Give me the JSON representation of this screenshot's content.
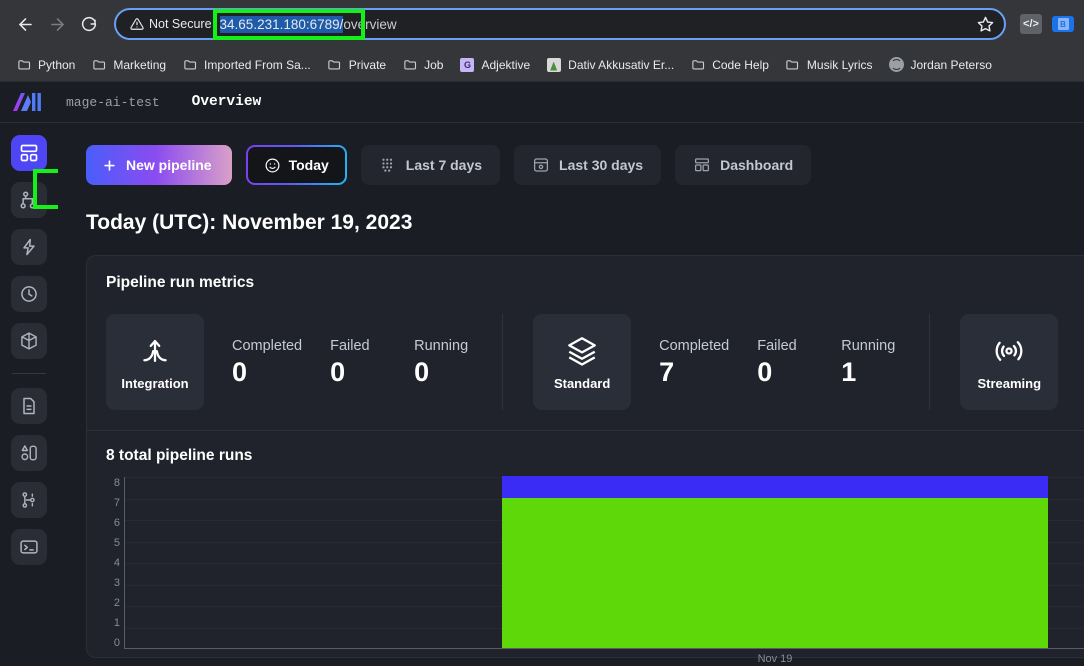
{
  "browser": {
    "back_icon": "back-arrow-icon",
    "forward_icon": "forward-arrow-icon",
    "reload_icon": "reload-icon",
    "security_label": "Not Secure",
    "url_selected": "34.65.231.180:6789/",
    "url_rest": "overview",
    "star_icon": "star-icon",
    "ext_code_label": "</>",
    "ext_badge_label": "B",
    "bookmarks": [
      {
        "label": "Python",
        "icon": "folder-icon"
      },
      {
        "label": "Marketing",
        "icon": "folder-icon"
      },
      {
        "label": "Imported From Sa...",
        "icon": "folder-icon"
      },
      {
        "label": "Private",
        "icon": "folder-icon"
      },
      {
        "label": "Job",
        "icon": "folder-icon"
      },
      {
        "label": "Adjektive",
        "icon": "grammar-favicon",
        "badge": "G"
      },
      {
        "label": "Dativ Akkusativ Er...",
        "icon": "image-favicon"
      },
      {
        "label": "Code Help",
        "icon": "folder-icon"
      },
      {
        "label": "Musik Lyrics",
        "icon": "folder-icon"
      },
      {
        "label": "Jordan Peterso",
        "icon": "globe-favicon"
      }
    ]
  },
  "app": {
    "logo": "mage-logo",
    "project_name": "mage-ai-test",
    "page_title": "Overview"
  },
  "sidebar": {
    "items": [
      {
        "name": "sidebar-item-overview",
        "icon": "dashboard-icon",
        "active": true
      },
      {
        "name": "sidebar-item-pipelines",
        "icon": "pipeline-tree-icon",
        "active": false
      },
      {
        "name": "sidebar-item-triggers",
        "icon": "lightning-icon",
        "active": false
      },
      {
        "name": "sidebar-item-runs",
        "icon": "clock-icon",
        "active": false
      },
      {
        "name": "sidebar-item-blocks",
        "icon": "cube-icon",
        "active": false
      },
      {
        "name": "sidebar-item-files",
        "icon": "file-icon",
        "active": false
      },
      {
        "name": "sidebar-item-charts",
        "icon": "chart-shapes-icon",
        "active": false
      },
      {
        "name": "sidebar-item-version-control",
        "icon": "git-branch-icon",
        "active": false
      },
      {
        "name": "sidebar-item-terminal",
        "icon": "terminal-icon",
        "active": false
      }
    ]
  },
  "toolbar": {
    "new_pipeline": "New pipeline",
    "new_pipeline_icon": "plus-icon",
    "today": "Today",
    "today_icon": "smiley-icon",
    "last_7_days": "Last 7 days",
    "last_7_days_icon": "dots-grid-icon",
    "last_30_days": "Last 30 days",
    "last_30_days_icon": "calendar-box-icon",
    "dashboard": "Dashboard",
    "dashboard_icon": "layout-icon"
  },
  "main": {
    "date_heading": "Today (UTC): November 19, 2023",
    "metrics_panel_title": "Pipeline run metrics",
    "metric_groups": [
      {
        "tile_label": "Integration",
        "tile_icon": "integration-icon",
        "stats": [
          {
            "label": "Completed",
            "value": "0"
          },
          {
            "label": "Failed",
            "value": "0"
          },
          {
            "label": "Running",
            "value": "0"
          }
        ]
      },
      {
        "tile_label": "Standard",
        "tile_icon": "layers-icon",
        "stats": [
          {
            "label": "Completed",
            "value": "7"
          },
          {
            "label": "Failed",
            "value": "0"
          },
          {
            "label": "Running",
            "value": "1"
          }
        ]
      },
      {
        "tile_label": "Streaming",
        "tile_icon": "streaming-waves-icon",
        "stats": []
      }
    ],
    "chart_heading": "8 total pipeline runs"
  },
  "chart_data": {
    "type": "bar",
    "title": "8 total pipeline runs",
    "categories": [
      "Nov 19"
    ],
    "series": [
      {
        "name": "completed",
        "values": [
          7
        ],
        "color": "#5fd80a"
      },
      {
        "name": "running",
        "values": [
          1
        ],
        "color": "#3a2bf5"
      }
    ],
    "stacked": true,
    "xlabel": "",
    "ylabel": "",
    "ylim": [
      0,
      8
    ],
    "yticks": [
      "8",
      "7",
      "6",
      "5",
      "4",
      "3",
      "2",
      "1",
      "0"
    ],
    "grid": true,
    "legend": "none"
  },
  "colors": {
    "accent_blue": "#4e45f5",
    "chart_completed": "#5fd80a",
    "chart_running": "#3a2bf5",
    "annotation_green": "#16f01a",
    "page_bg": "#1b1d24",
    "panel_bg": "#20232b"
  }
}
